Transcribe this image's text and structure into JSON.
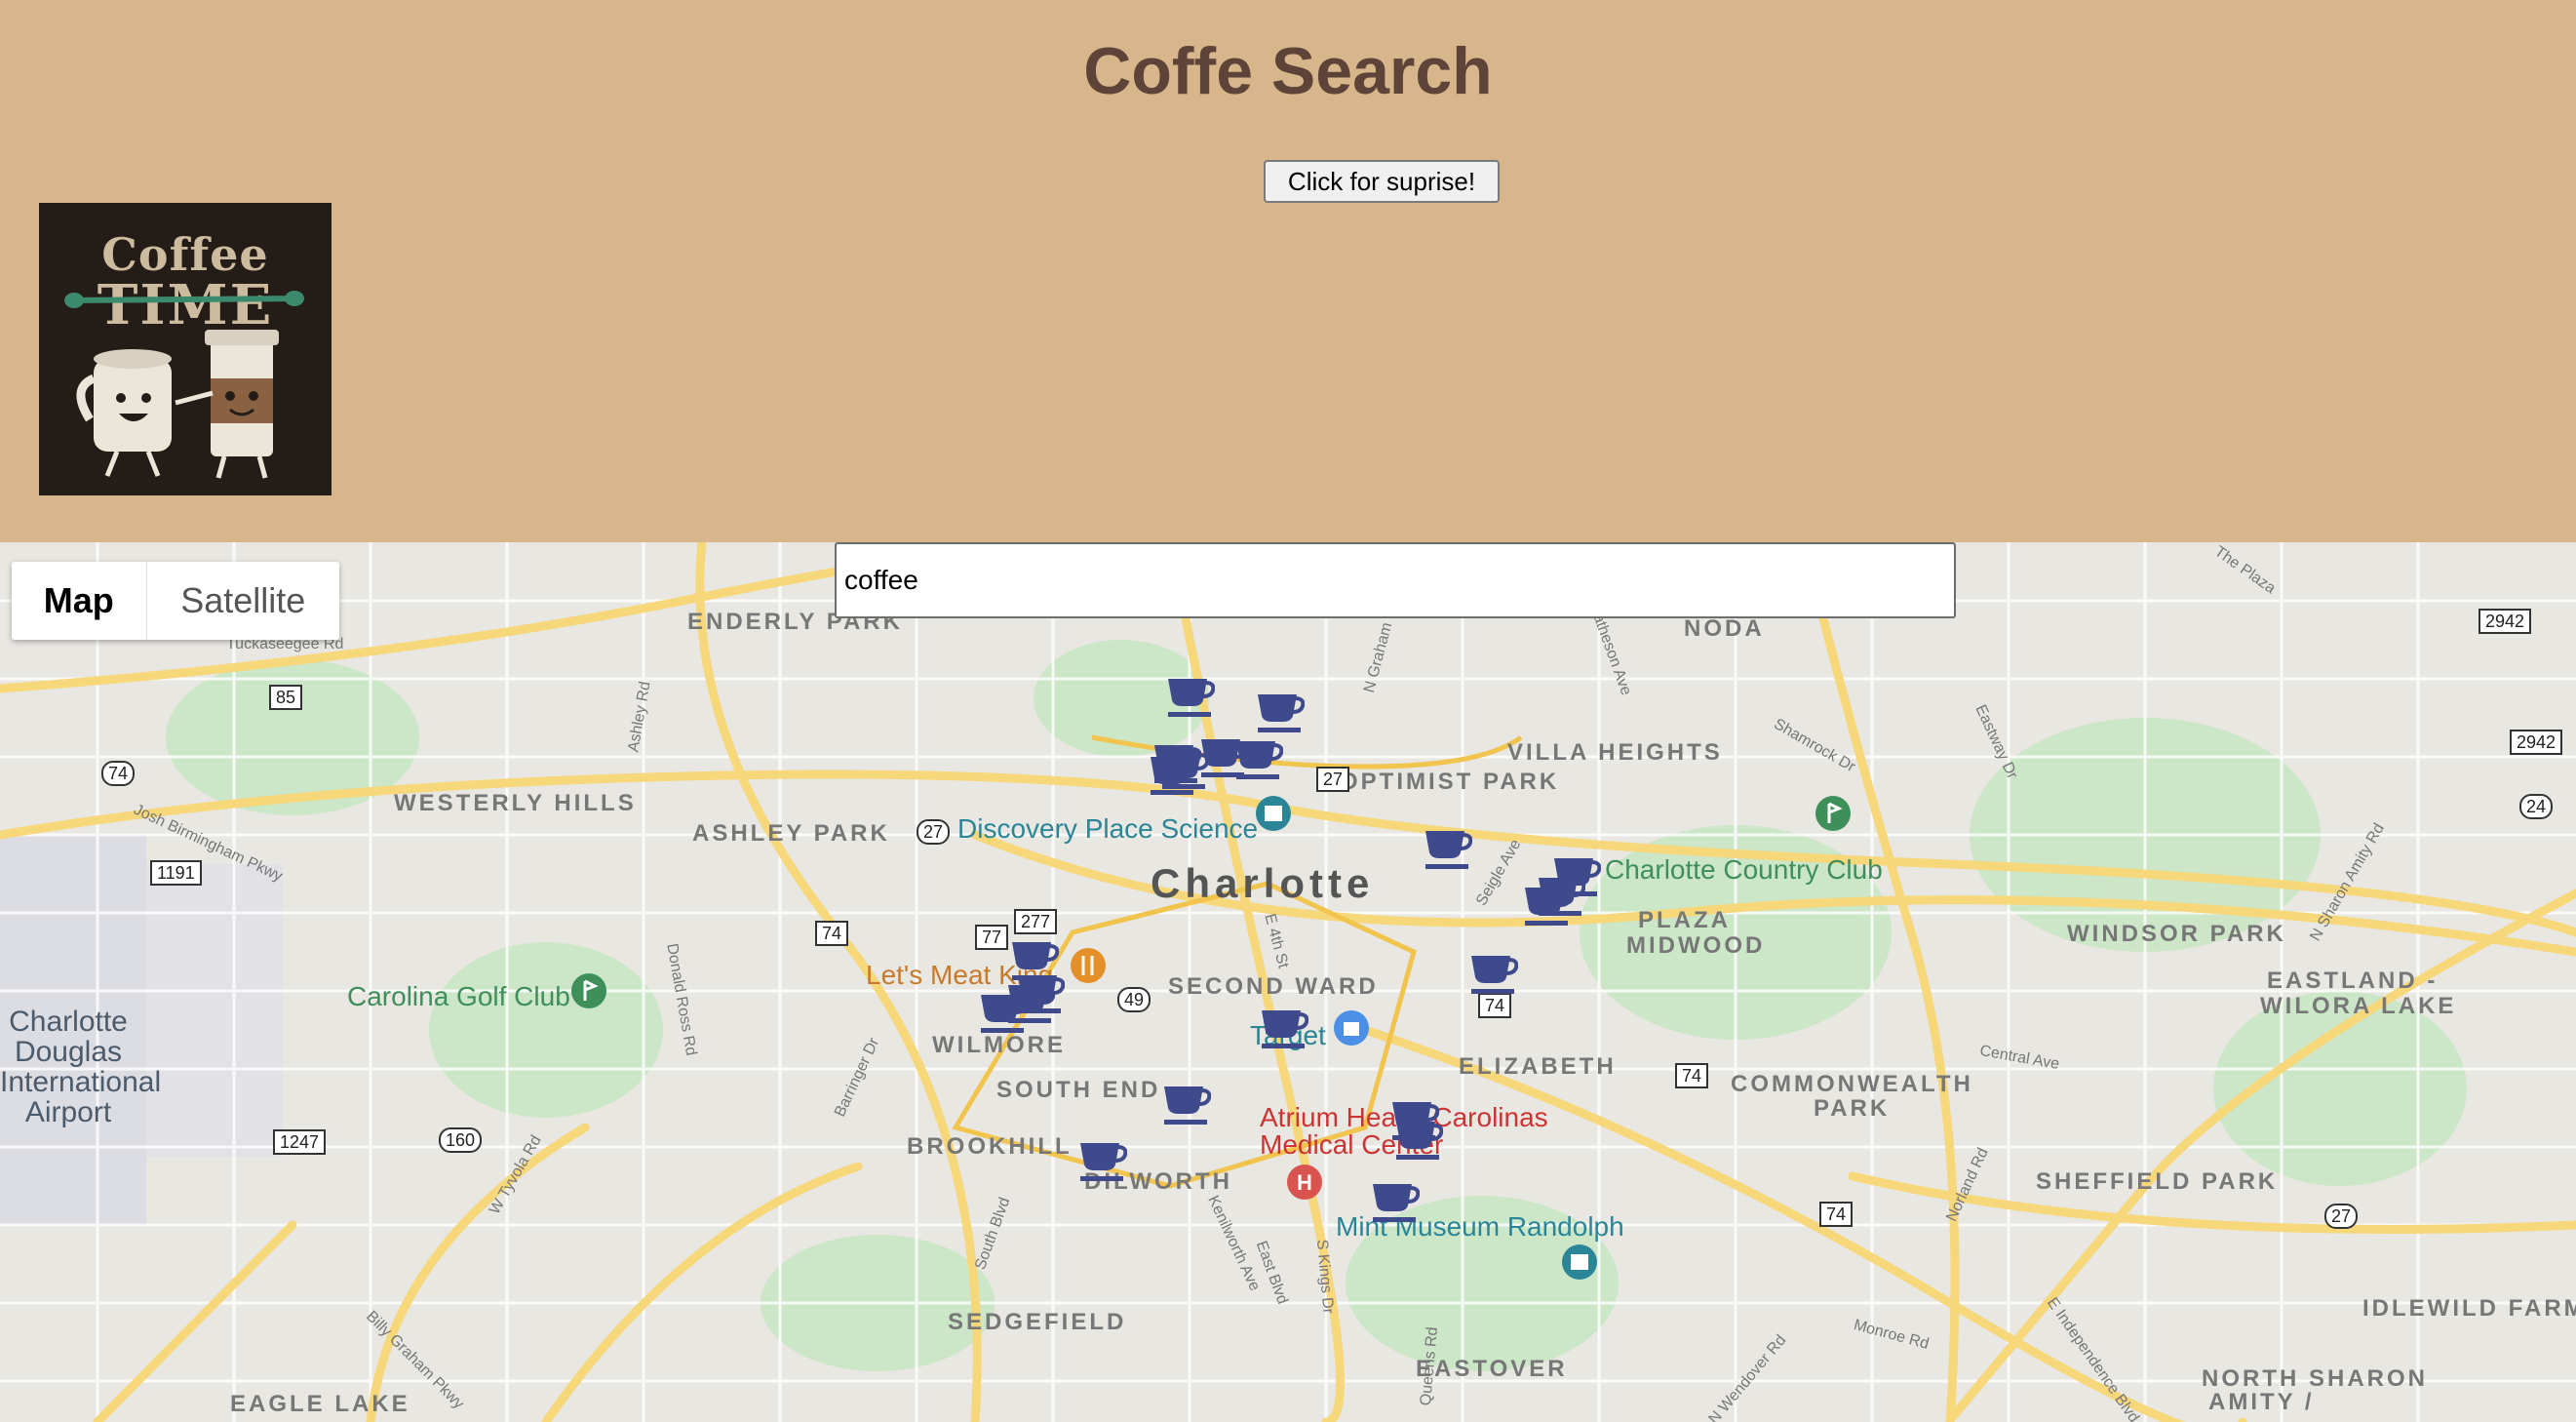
{
  "header": {
    "title": "Coffe Search",
    "surprise_button": "Click for suprise!",
    "logo": {
      "line1": "Coffee",
      "line2": "TIME"
    }
  },
  "map": {
    "search_value": "coffee",
    "map_type_control": {
      "map_label": "Map",
      "satellite_label": "Satellite",
      "selected": "Map"
    },
    "city_label": "Charlotte",
    "neighborhoods": [
      "ENDERLY PARK",
      "NODA",
      "VILLA HEIGHTS",
      "OPTIMIST PARK",
      "WESTERLY HILLS",
      "ASHLEY PARK",
      "PLAZA",
      "MIDWOOD",
      "WINDSOR PARK",
      "EASTLAND -",
      "WILORA LAKE",
      "SECOND WARD",
      "WILMORE",
      "SOUTH END",
      "ELIZABETH",
      "COMMONWEALTH",
      "PARK",
      "BROOKHILL",
      "DILWORTH",
      "SHEFFIELD PARK",
      "SEDGEFIELD",
      "EASTOVER",
      "IDLEWILD FARM",
      "NORTH SHARON",
      "AMITY /",
      "EAGLE LAKE"
    ],
    "places": {
      "discovery": "Discovery Place Science",
      "country_club": "Charlotte Country Club",
      "golf_club": "Carolina Golf Club",
      "meat_king": "Let's Meat King",
      "target": "Target",
      "atrium_1": "Atrium Health Carolinas",
      "atrium_2": "Medical Center",
      "mint": "Mint Museum Randolph",
      "airport_1": "Charlotte",
      "airport_2": "Douglas",
      "airport_3": "International",
      "airport_4": "Airport"
    },
    "streets": [
      "Tuckaseegee Rd",
      "Ashley Rd",
      "Josh Birmingham Pkwy",
      "Donald Ross Rd",
      "Barringer Dr",
      "W Tyvola Rd",
      "Billy Graham Pkwy",
      "South Blvd",
      "Kenilworth Ave",
      "East Blvd",
      "S Kings Dr",
      "Queens Rd",
      "Monroe Rd",
      "N Wendover Rd",
      "E Independence Blvd",
      "Central Ave",
      "Eastway Dr",
      "Shamrock Dr",
      "The Plaza",
      "N Sharon Amity Rd",
      "Norland Rd",
      "Seigle Ave",
      "N Graham St",
      "E 4th St",
      "Matheson Ave"
    ],
    "route_shields": [
      "85",
      "74",
      "1191",
      "27",
      "77",
      "277",
      "74",
      "49",
      "74",
      "160",
      "1247",
      "74",
      "74",
      "27",
      "2942",
      "2942",
      "24",
      "27"
    ],
    "coffee_marker_icon": "coffee-cup-icon",
    "coffee_marker_color": "#3f4a8c",
    "coffee_marker_count": 22
  }
}
